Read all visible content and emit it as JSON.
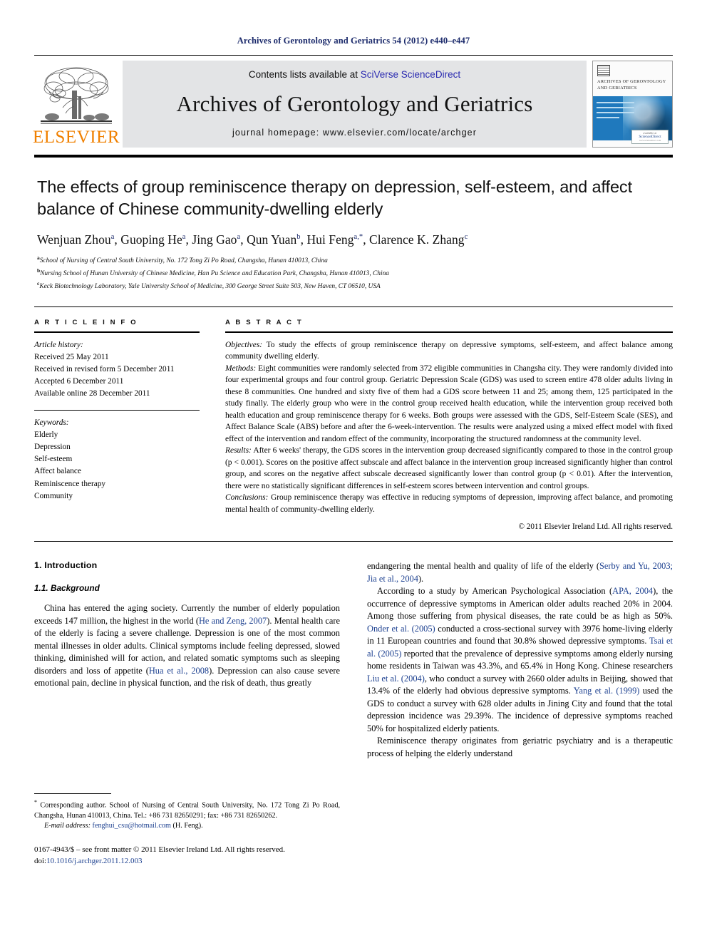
{
  "running_head": "Archives of Gerontology and Geriatrics 54 (2012) e440–e447",
  "masthead": {
    "contents_prefix": "Contents lists available at ",
    "sciencedirect": "SciVerse ScienceDirect",
    "journal_name": "Archives of Gerontology and Geriatrics",
    "homepage": "journal homepage: www.elsevier.com/locate/archger",
    "publisher": "ELSEVIER",
    "cover_title_line1": "ARCHIVES OF GERONTOLOGY",
    "cover_title_line2": "AND GERIATRICS",
    "cover_sd_small": "available at",
    "cover_sd_name": "ScienceDirect",
    "cover_sd_sub": "www.sciencedirect.com"
  },
  "article": {
    "title": "The effects of group reminiscence therapy on depression, self-esteem, and affect balance of Chinese community-dwelling elderly",
    "authors": [
      {
        "name": "Wenjuan Zhou",
        "marks": "a"
      },
      {
        "name": "Guoping He",
        "marks": "a"
      },
      {
        "name": "Jing Gao",
        "marks": "a"
      },
      {
        "name": "Qun Yuan",
        "marks": "b"
      },
      {
        "name": "Hui Feng",
        "marks": "a,*"
      },
      {
        "name": "Clarence K. Zhang",
        "marks": "c"
      }
    ],
    "affiliations": [
      {
        "mark": "a",
        "text": "School of Nursing of Central South University, No. 172 Tong Zi Po Road, Changsha, Hunan 410013, China"
      },
      {
        "mark": "b",
        "text": "Nursing School of Hunan University of Chinese Medicine, Han Pu Science and Education Park, Changsha, Hunan 410013, China"
      },
      {
        "mark": "c",
        "text": "Keck Biotechnology Laboratory, Yale University School of Medicine, 300 George Street Suite 503, New Haven, CT 06510, USA"
      }
    ]
  },
  "article_info": {
    "heading": "A R T I C L E   I N F O",
    "history_label": "Article history:",
    "history": [
      "Received 25 May 2011",
      "Received in revised form 5 December 2011",
      "Accepted 6 December 2011",
      "Available online 28 December 2011"
    ],
    "keywords_label": "Keywords:",
    "keywords": [
      "Elderly",
      "Depression",
      "Self-esteem",
      "Affect balance",
      "Reminiscence therapy",
      "Community"
    ]
  },
  "abstract": {
    "heading": "A B S T R A C T",
    "objectives_label": "Objectives:",
    "objectives_text": " To study the effects of group reminiscence therapy on depressive symptoms, self-esteem, and affect balance among community dwelling elderly.",
    "methods_label": "Methods:",
    "methods_text": " Eight communities were randomly selected from 372 eligible communities in Changsha city. They were randomly divided into four experimental groups and four control group. Geriatric Depression Scale (GDS) was used to screen entire 478 older adults living in these 8 communities. One hundred and sixty five of them had a GDS score between 11 and 25; among them, 125 participated in the study finally. The elderly group who were in the control group received health education, while the intervention group received both health education and group reminiscence therapy for 6 weeks. Both groups were assessed with the GDS, Self-Esteem Scale (SES), and Affect Balance Scale (ABS) before and after the 6-week-intervention. The results were analyzed using a mixed effect model with fixed effect of the intervention and random effect of the community, incorporating the structured randomness at the community level.",
    "results_label": "Results:",
    "results_text": " After 6 weeks' therapy, the GDS scores in the intervention group decreased significantly compared to those in the control group (p < 0.001). Scores on the positive affect subscale and affect balance in the intervention group increased significantly higher than control group, and scores on the negative affect subscale decreased significantly lower than control group (p < 0.01). After the intervention, there were no statistically significant differences in self-esteem scores between intervention and control groups.",
    "conclusions_label": "Conclusions:",
    "conclusions_text": " Group reminiscence therapy was effective in reducing symptoms of depression, improving affect balance, and promoting mental health of community-dwelling elderly.",
    "copyright": "© 2011 Elsevier Ireland Ltd. All rights reserved."
  },
  "body": {
    "section1_heading": "1. Introduction",
    "subsection11_heading": "1.1. Background",
    "left_p1_a": "China has entered the aging society. Currently the number of elderly population exceeds 147 million, the highest in the world (",
    "left_p1_ref1": "He and Zeng, 2007",
    "left_p1_b": "). Mental health care of the elderly is facing a severe challenge. Depression is one of the most common mental illnesses in older adults. Clinical symptoms include feeling depressed, slowed thinking, diminished will for action, and related somatic symptoms such as sleeping disorders and loss of appetite (",
    "left_p1_ref2": "Hua et al., 2008",
    "left_p1_c": "). Depression can also cause severe emotional pain, decline in physical function, and the risk of death, thus greatly",
    "right_p1_a": "endangering the mental health and quality of life of the elderly (",
    "right_p1_ref1": "Serby and Yu, 2003; Jia et al., 2004",
    "right_p1_b": ").",
    "right_p2_a": "According to a study by American Psychological Association (",
    "right_p2_ref1": "APA, 2004",
    "right_p2_b": "), the occurrence of depressive symptoms in American older adults reached 20% in 2004. Among those suffering from physical diseases, the rate could be as high as 50%. ",
    "right_p2_ref2": "Onder et al. (2005)",
    "right_p2_c": " conducted a cross-sectional survey with 3976 home-living elderly in 11 European countries and found that 30.8% showed depressive symptoms. ",
    "right_p2_ref3": "Tsai et al. (2005)",
    "right_p2_d": " reported that the prevalence of depressive symptoms among elderly nursing home residents in Taiwan was 43.3%, and 65.4% in Hong Kong. Chinese researchers ",
    "right_p2_ref4": "Liu et al. (2004)",
    "right_p2_e": ", who conduct a survey with 2660 older adults in Beijing, showed that 13.4% of the elderly had obvious depressive symptoms. ",
    "right_p2_ref5": "Yang et al. (1999)",
    "right_p2_f": " used the GDS to conduct a survey with 628 older adults in Jining City and found that the total depression incidence was 29.39%. The incidence of depressive symptoms reached 50% for hospitalized elderly patients.",
    "right_p3": "Reminiscence therapy originates from geriatric psychiatry and is a therapeutic process of helping the elderly understand"
  },
  "footnotes": {
    "corresponding_star": "*",
    "corresponding": " Corresponding author. School of Nursing of Central South University, No. 172 Tong Zi Po Road, Changsha, Hunan 410013, China. Tel.: +86 731 82650291; fax: +86 731 82650262.",
    "email_label": "E-mail address:",
    "email": "fenghui_csu@hotmail.com",
    "email_suffix": " (H. Feng).",
    "imprint_line1": "0167-4943/$ – see front matter © 2011 Elsevier Ireland Ltd. All rights reserved.",
    "imprint_doi_label": "doi:",
    "imprint_doi": "10.1016/j.archger.2011.12.003"
  },
  "colors": {
    "running_head": "#1b2a6b",
    "link": "#1b3f8f",
    "elsevier_orange": "#f08000",
    "band_gray": "#e3e4e6"
  }
}
